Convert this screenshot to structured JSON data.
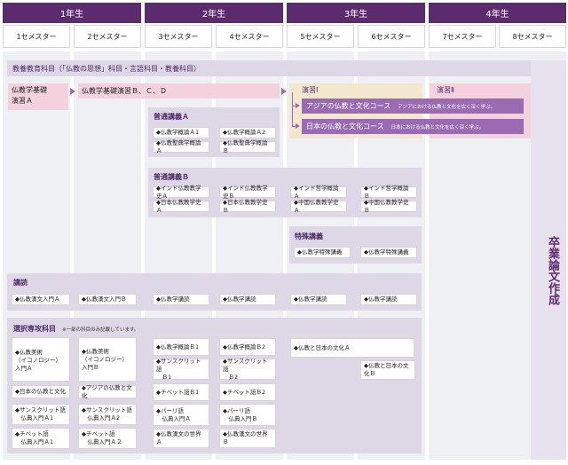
{
  "years": [
    "1年生",
    "2年生",
    "3年生",
    "4年生"
  ],
  "semesters": [
    "1セメスター",
    "2セメスター",
    "3セメスター",
    "4セメスター",
    "5セメスター",
    "6セメスター",
    "7セメスター",
    "8セメスター"
  ],
  "general": {
    "label": "教養教育科目（「仏教の思想」科目・言語科目・教養科目）"
  },
  "basic": {
    "a": "仏教学基礎\n演習Ａ",
    "bcd": "仏教学基礎演習Ｂ、Ｃ、Ｄ"
  },
  "seminar1": {
    "label": "演習Ⅰ",
    "course1": "アジアの仏教と文化コース",
    "course1_sub": "アジアにおける仏教と文化を広く深く学ぶ。",
    "course2": "日本の仏教と文化コース",
    "course2_sub": "日本における仏教と文化を広く深く学ぶ。"
  },
  "seminar2": {
    "label": "演習Ⅱ"
  },
  "ippanA": {
    "label": "普通講義Ａ",
    "items": [
      "◆仏教学概論Ａ1",
      "◆仏教学概論Ａ2",
      "◆仏教聖典学概論Ａ",
      "◆仏教聖典学概論Ｂ"
    ]
  },
  "ippanB": {
    "label": "普通講義Ｂ",
    "items": [
      "◆インド仏教教学史Ａ",
      "◆インド仏教教学史Ｂ",
      "◆インド哲学概論Ａ",
      "◆インド哲学概論Ｂ",
      "◆日本仏教教学史Ａ",
      "◆日本仏教教学史Ｂ",
      "◆中国仏教教学史Ａ",
      "◆中国仏教教学史Ｂ"
    ]
  },
  "special": {
    "label": "特殊講義",
    "items": [
      "◆仏教学特殊講義",
      "◆仏教学特殊講義"
    ]
  },
  "reading": {
    "label": "講読",
    "items": [
      "◆仏教漢文入門Ａ",
      "◆仏教漢文入門Ｂ",
      "◆仏教学講読",
      "◆仏教学講読",
      "◆仏教学講読",
      "◆仏教学講読"
    ]
  },
  "elective": {
    "label": "選択専攻科目",
    "note": "※一部の科目のみ記載しています。",
    "col1": [
      "◆仏教美術\n（イコノロジー）入門Ａ",
      "◆日本の仏教と文化",
      "◆サンスクリット語\n　仏典入門Ａ1",
      "◆チベット語\n　仏典入門Ａ1"
    ],
    "col2": [
      "◆仏教美術\n（イコノロジー）入門Ｂ",
      "◆アジアの仏教と文化",
      "◆サンスクリット語\n　仏典入門Ａ2",
      "◆チベット語\n　仏典入門Ａ２"
    ],
    "col3": [
      "◆仏教学概論Ｂ1",
      "◆サンスクリット語\n　Ｂ1",
      "◆チベット語Ｂ1",
      "◆パーリ語\n　仏典入門Ａ",
      "◆仏教漢文の世界Ａ"
    ],
    "col4": [
      "◆仏教学概論Ｂ2",
      "◆サンスクリット語\n　Ｂ2",
      "◆チベット語Ｂ2",
      "◆パーリ語\n　仏典入門Ｂ",
      "◆仏教漢文の世界Ｂ"
    ],
    "col5": "◆仏教と日本の文化Ａ",
    "col6": "◆仏教と日本の文化Ｂ"
  },
  "thesis": "卒業論文作成",
  "colors": {
    "header": "#5c2b6e",
    "band": "#ddd7e6",
    "pink": "#f3d1dd",
    "button": "#9a6bb2",
    "tan": "#f4e7cf"
  }
}
